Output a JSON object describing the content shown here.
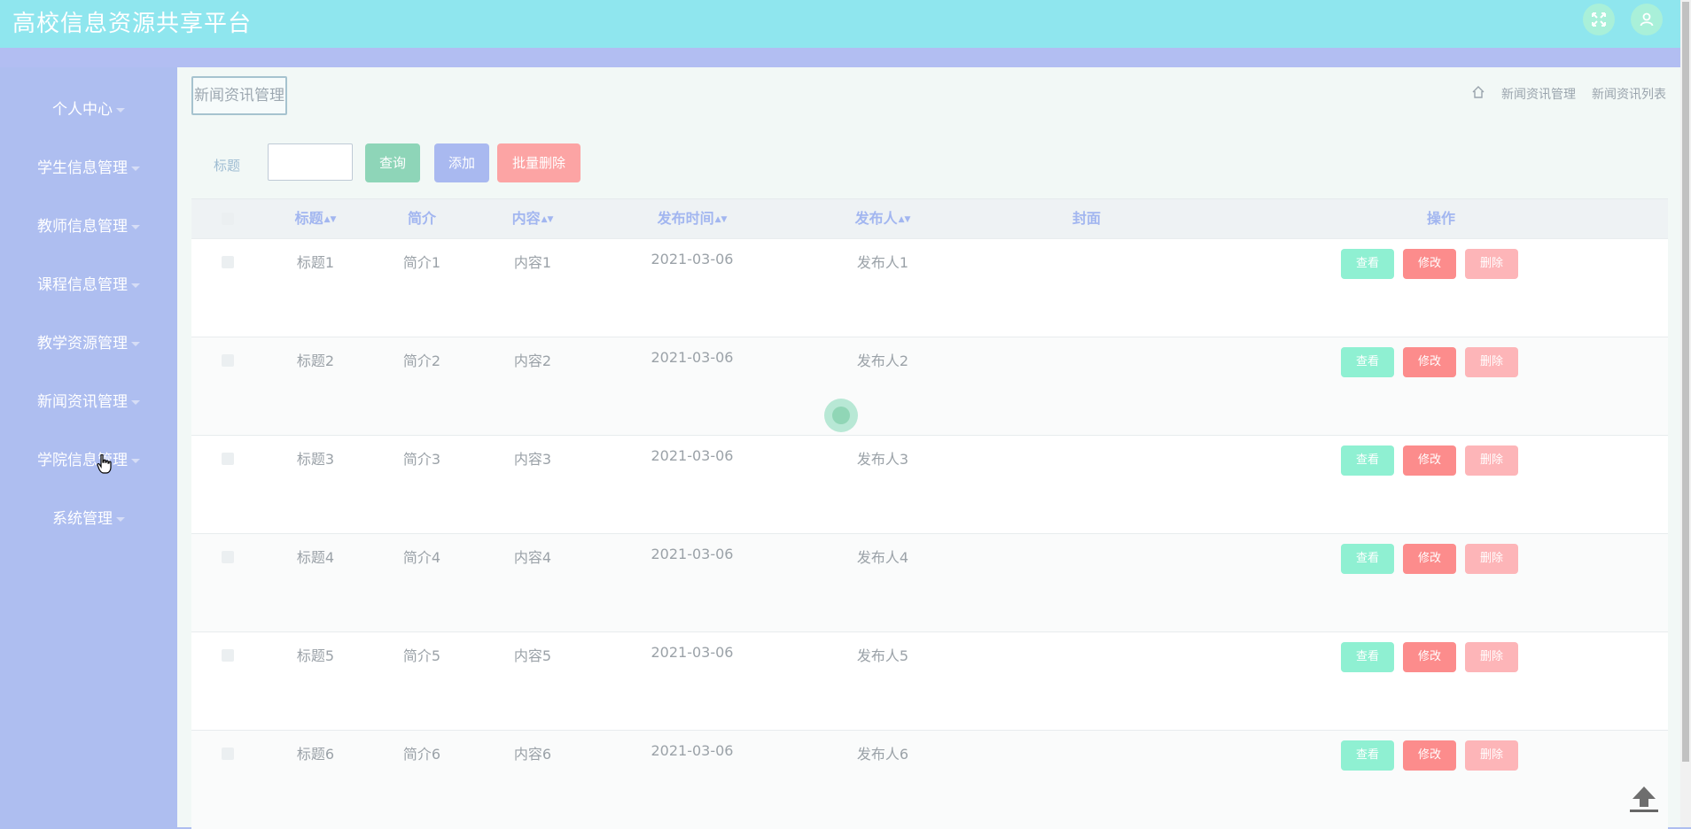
{
  "app": {
    "title": "高校信息资源共享平台"
  },
  "header": {
    "icons": [
      "fullscreen-icon",
      "user-icon"
    ]
  },
  "sidebar": {
    "items": [
      {
        "label": "个人中心"
      },
      {
        "label": "学生信息管理"
      },
      {
        "label": "教师信息管理"
      },
      {
        "label": "课程信息管理"
      },
      {
        "label": "教学资源管理"
      },
      {
        "label": "新闻资讯管理"
      },
      {
        "label": "学院信息管理"
      },
      {
        "label": "系统管理"
      }
    ]
  },
  "page": {
    "section_tag": "新闻资讯管理",
    "breadcrumb": [
      "新闻资讯管理",
      "新闻资讯列表"
    ]
  },
  "filter": {
    "label": "标题",
    "input_value": "",
    "search_button": "查询",
    "add_button": "添加",
    "batch_delete_button": "批量删除"
  },
  "table": {
    "columns": [
      "标题",
      "简介",
      "内容",
      "发布时间",
      "发布人",
      "封面",
      "操作"
    ],
    "sortable": [
      true,
      false,
      true,
      true,
      true,
      false,
      false
    ],
    "rows": [
      {
        "title": "标题1",
        "intro": "简介1",
        "content": "内容1",
        "date": "2021-03-06",
        "author": "发布人1",
        "cover": ""
      },
      {
        "title": "标题2",
        "intro": "简介2",
        "content": "内容2",
        "date": "2021-03-06",
        "author": "发布人2",
        "cover": ""
      },
      {
        "title": "标题3",
        "intro": "简介3",
        "content": "内容3",
        "date": "2021-03-06",
        "author": "发布人3",
        "cover": ""
      },
      {
        "title": "标题4",
        "intro": "简介4",
        "content": "内容4",
        "date": "2021-03-06",
        "author": "发布人4",
        "cover": ""
      },
      {
        "title": "标题5",
        "intro": "简介5",
        "content": "内容5",
        "date": "2021-03-06",
        "author": "发布人5",
        "cover": ""
      },
      {
        "title": "标题6",
        "intro": "简介6",
        "content": "内容6",
        "date": "2021-03-06",
        "author": "发布人6",
        "cover": ""
      }
    ],
    "actions": {
      "view": "查看",
      "edit": "修改",
      "delete": "删除"
    }
  },
  "colors": {
    "header_bg": "#8fe6ee",
    "sidebar_bg": "#aebef0",
    "main_bg": "#f2f8f6",
    "search_btn": "#8ed5b8",
    "add_btn": "#a9b9f0",
    "batch_delete_btn": "#fca4a4",
    "view_btn": "#8ff0d2",
    "edit_btn": "#fc8c8c",
    "delete_btn": "#fdb5b8",
    "column_header_text": "#a2b6f0"
  }
}
